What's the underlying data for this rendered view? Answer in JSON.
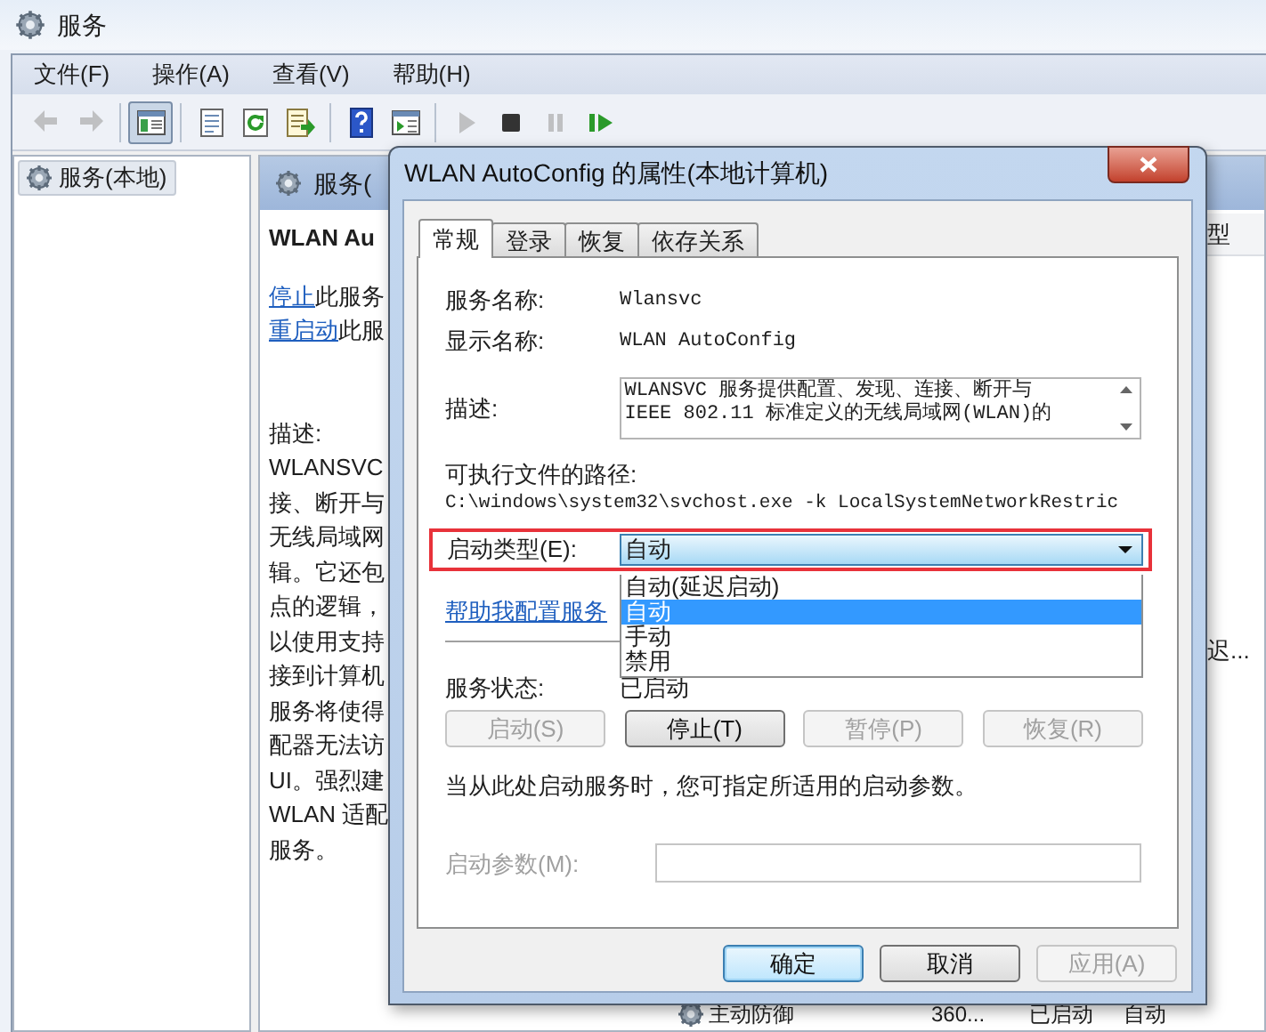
{
  "window": {
    "title": "服务"
  },
  "menu": [
    "文件(F)",
    "操作(A)",
    "查看(V)",
    "帮助(H)"
  ],
  "toolbar": [
    {
      "kind": "back",
      "disabled": true,
      "pressed": false
    },
    {
      "kind": "forward",
      "disabled": true,
      "pressed": false
    },
    {
      "kind": "tree",
      "disabled": false,
      "pressed": true
    },
    {
      "kind": "properties",
      "disabled": false,
      "pressed": false
    },
    {
      "kind": "refresh",
      "disabled": false,
      "pressed": false
    },
    {
      "kind": "export",
      "disabled": false,
      "pressed": false
    },
    {
      "kind": "help",
      "disabled": false,
      "pressed": false
    },
    {
      "kind": "console",
      "disabled": false,
      "pressed": false
    },
    {
      "kind": "start",
      "disabled": true,
      "pressed": false
    },
    {
      "kind": "stop",
      "disabled": false,
      "pressed": false
    },
    {
      "kind": "pause",
      "disabled": true,
      "pressed": false
    },
    {
      "kind": "resume",
      "disabled": false,
      "pressed": false
    }
  ],
  "tree": {
    "items": [
      {
        "label": "服务(本地)",
        "selected": true
      }
    ]
  },
  "services_panel": {
    "header": "服务(",
    "service_name": "WLAN Au",
    "actions": [
      {
        "link": "停止",
        "text": "此服务"
      },
      {
        "link": "重启动",
        "text": "此服"
      }
    ],
    "description_label": "描述:",
    "description_lines": [
      "WLANSVC",
      "接、断开与",
      "无线局域网",
      "辑。它还包",
      "点的逻辑，",
      "以使用支持",
      "接到计算机",
      "服务将使得",
      "配器无法访",
      "UI。强烈建",
      "WLAN 适配",
      "服务。"
    ]
  },
  "list": {
    "column_header": "型",
    "row_fragment": "迟...",
    "bottom_row": [
      "主动防御",
      "360...",
      "已启动",
      "自动"
    ]
  },
  "dialog": {
    "title": "WLAN AutoConfig 的属性(本地计算机)",
    "tabs": [
      {
        "label": "常规",
        "selected": true
      },
      {
        "label": "登录",
        "selected": false
      },
      {
        "label": "恢复",
        "selected": false
      },
      {
        "label": "依存关系",
        "selected": false
      }
    ],
    "service_name": {
      "label": "服务名称:",
      "value": "Wlansvc"
    },
    "display_name": {
      "label": "显示名称:",
      "value": "WLAN AutoConfig"
    },
    "description": {
      "label": "描述:",
      "lines": [
        "WLANSVC 服务提供配置、发现、连接、断开与",
        "IEEE 802.11 标准定义的无线局域网(WLAN)的"
      ]
    },
    "path": {
      "label": "可执行文件的路径:",
      "value": "C:\\windows\\system32\\svchost.exe -k LocalSystemNetworkRestric"
    },
    "startup_type": {
      "label": "启动类型(E):",
      "value": "自动",
      "highlighted": true,
      "options": [
        {
          "label": "自动(延迟启动)",
          "selected": false
        },
        {
          "label": "自动",
          "selected": true
        },
        {
          "label": "手动",
          "selected": false
        },
        {
          "label": "禁用",
          "selected": false
        }
      ]
    },
    "help_link": "帮助我配置服务",
    "status": {
      "label": "服务状态:",
      "value": "已启动"
    },
    "service_buttons": [
      {
        "label": "启动(S)",
        "disabled": true
      },
      {
        "label": "停止(T)",
        "disabled": false
      },
      {
        "label": "暂停(P)",
        "disabled": true
      },
      {
        "label": "恢复(R)",
        "disabled": true
      }
    ],
    "hint": "当从此处启动服务时，您可指定所适用的启动参数。",
    "parameters": {
      "label": "启动参数(M):",
      "disabled": true
    },
    "buttons": [
      {
        "label": "确定",
        "disabled": false,
        "default": true
      },
      {
        "label": "取消",
        "disabled": false,
        "default": false
      },
      {
        "label": "应用(A)",
        "disabled": true,
        "default": false
      }
    ]
  }
}
